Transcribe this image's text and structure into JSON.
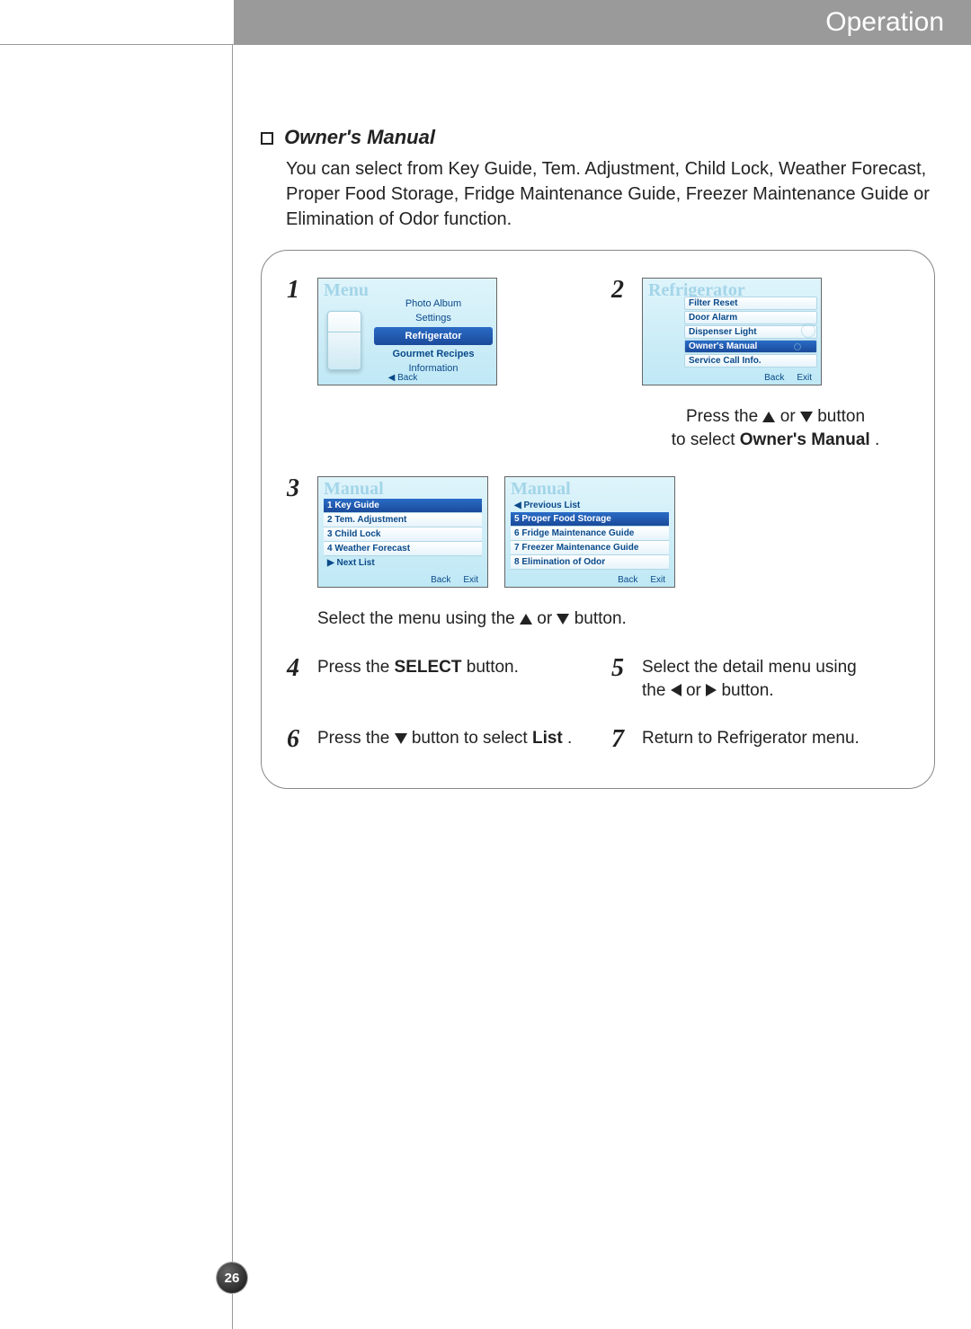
{
  "header": {
    "title": "Operation"
  },
  "section": {
    "title": "Owner's Manual",
    "intro": "You can select from Key Guide, Tem. Adjustment, Child Lock, Weather Forecast, Proper Food Storage, Fridge Maintenance Guide, Freezer Maintenance Guide or Elimination of Odor function."
  },
  "lcd1": {
    "corner": "Menu",
    "items": [
      "Photo Album",
      "Settings",
      "Refrigerator",
      "Gourmet Recipes",
      "Information"
    ],
    "selectedIndex": 2,
    "back": "◀ Back"
  },
  "lcd2": {
    "corner": "Refrigerator",
    "items": [
      "Filter Reset",
      "Door Alarm",
      "Dispenser Light",
      "Owner's Manual",
      "Service Call Info."
    ],
    "selectedIndex": 3,
    "back": "Back",
    "exit": "Exit"
  },
  "lcd3a": {
    "corner": "Manual",
    "items": [
      "1 Key Guide",
      "2 Tem. Adjustment",
      "3 Child Lock",
      "4 Weather Forecast"
    ],
    "selectedIndex": 0,
    "nav": "▶ Next List",
    "back": "Back",
    "exit": "Exit"
  },
  "lcd3b": {
    "corner": "Manual",
    "nav": "◀ Previous List",
    "items": [
      "5 Proper Food Storage",
      "6 Fridge Maintenance Guide",
      "7 Freezer Maintenance Guide",
      "8 Elimination of Odor"
    ],
    "selectedIndex": 0,
    "back": "Back",
    "exit": "Exit"
  },
  "steps": {
    "s1_num": "1",
    "s2_num": "2",
    "s2_a": "Press the ",
    "s2_b": " or ",
    "s2_c": " button",
    "s2_d": "to select ",
    "s2_e": "Owner's Manual",
    "s2_f": " .",
    "s3_num": "3",
    "s3_a": "Select the menu using the ",
    "s3_b": " or ",
    "s3_c": " button.",
    "s4_num": "4",
    "s4_a": "Press the ",
    "s4_b": "SELECT",
    "s4_c": " button.",
    "s5_num": "5",
    "s5_a": "Select the detail menu using",
    "s5_b": "the ",
    "s5_c": " or ",
    "s5_d": " button.",
    "s6_num": "6",
    "s6_a": "Press the ",
    "s6_b": " button to select ",
    "s6_c": "List",
    "s6_d": ".",
    "s7_num": "7",
    "s7_text": "Return to Refrigerator menu."
  },
  "page_number": "26"
}
